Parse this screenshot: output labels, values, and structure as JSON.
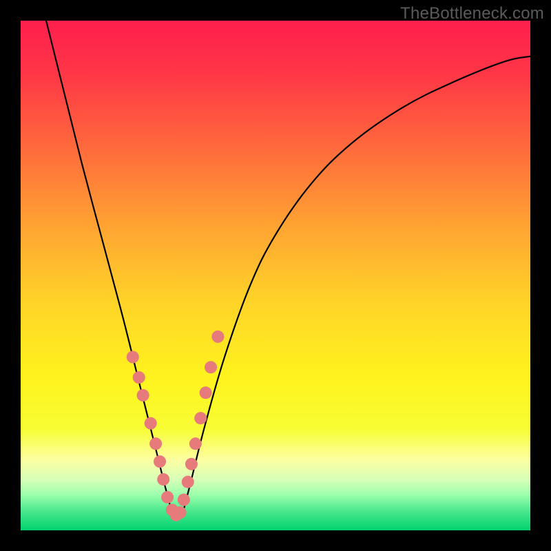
{
  "watermark": {
    "text": "TheBottleneck.com"
  },
  "gradient": {
    "stops": [
      {
        "offset": 0.0,
        "color": "#ff1f4e"
      },
      {
        "offset": 0.1,
        "color": "#ff3547"
      },
      {
        "offset": 0.25,
        "color": "#ff6a3c"
      },
      {
        "offset": 0.4,
        "color": "#ffa232"
      },
      {
        "offset": 0.55,
        "color": "#ffd328"
      },
      {
        "offset": 0.7,
        "color": "#fff31e"
      },
      {
        "offset": 0.8,
        "color": "#f7fd33"
      },
      {
        "offset": 0.86,
        "color": "#fdffa0"
      },
      {
        "offset": 0.9,
        "color": "#d8ffb8"
      },
      {
        "offset": 0.93,
        "color": "#9cffac"
      },
      {
        "offset": 0.96,
        "color": "#4fe98f"
      },
      {
        "offset": 1.0,
        "color": "#00d36e"
      }
    ]
  },
  "chart_data": {
    "type": "line",
    "title": "",
    "xlabel": "",
    "ylabel": "",
    "xlim": [
      0,
      100
    ],
    "ylim": [
      0,
      100
    ],
    "series": [
      {
        "name": "bottleneck-curve",
        "x": [
          5,
          8,
          12,
          16,
          20,
          23,
          25,
          27,
          28.5,
          30,
          31.5,
          33,
          36,
          40,
          45,
          50,
          57,
          65,
          75,
          85,
          95,
          100
        ],
        "values": [
          100,
          88,
          72,
          57,
          42,
          30,
          22,
          14,
          8,
          3,
          3,
          8,
          20,
          34,
          48,
          58,
          68,
          76,
          83,
          88,
          92,
          93
        ]
      }
    ],
    "markers": {
      "name": "highlight-dots",
      "color": "#e77b7b",
      "radius_px": 9,
      "x": [
        22.0,
        23.2,
        24.0,
        25.5,
        26.5,
        27.3,
        28.0,
        28.8,
        29.7,
        30.5,
        31.3,
        32.0,
        32.8,
        33.5,
        34.3,
        35.3,
        36.3,
        37.3,
        38.7
      ],
      "values": [
        34.0,
        30.0,
        26.5,
        21.0,
        17.0,
        13.5,
        10.0,
        6.5,
        4.0,
        3.0,
        3.5,
        6.0,
        9.5,
        13.0,
        17.0,
        22.0,
        27.0,
        32.0,
        38.0
      ]
    }
  }
}
